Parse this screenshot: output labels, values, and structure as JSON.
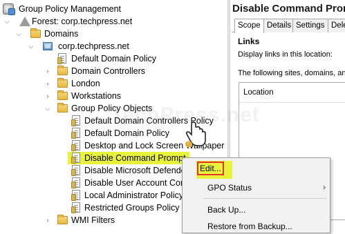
{
  "tree": {
    "items": [
      {
        "label": "Group Policy Management",
        "icon": "gpm-icon",
        "expander": "",
        "selected": false
      },
      {
        "label": "Forest: corp.techpress.net",
        "icon": "forest-icon",
        "expander": "expanded",
        "selected": false
      },
      {
        "label": "Domains",
        "icon": "folder-icon",
        "expander": "expanded",
        "selected": false
      },
      {
        "label": "corp.techpress.net",
        "icon": "domain-icon",
        "expander": "expanded",
        "selected": false
      },
      {
        "label": "Default Domain Policy",
        "icon": "gpo-link-icon",
        "expander": "",
        "selected": false
      },
      {
        "label": "Domain Controllers",
        "icon": "folder-icon",
        "expander": "collapsed",
        "selected": false
      },
      {
        "label": "London",
        "icon": "folder-icon",
        "expander": "collapsed",
        "selected": false
      },
      {
        "label": "Workstations",
        "icon": "folder-icon",
        "expander": "collapsed",
        "selected": false
      },
      {
        "label": "Group Policy Objects",
        "icon": "folder-icon",
        "expander": "expanded",
        "selected": false
      },
      {
        "label": "Default Domain Controllers Policy",
        "icon": "gpo-icon",
        "expander": "",
        "selected": false
      },
      {
        "label": "Default Domain Policy",
        "icon": "gpo-icon",
        "expander": "",
        "selected": false
      },
      {
        "label": "Desktop and Lock Screen Wallpaper",
        "icon": "gpo-icon",
        "expander": "",
        "selected": false
      },
      {
        "label": "Disable Command Prompt",
        "icon": "gpo-icon",
        "expander": "",
        "selected": true
      },
      {
        "label": "Disable Microsoft Defender",
        "icon": "gpo-icon",
        "expander": "",
        "selected": false
      },
      {
        "label": "Disable User Account Control",
        "icon": "gpo-icon",
        "expander": "",
        "selected": false
      },
      {
        "label": "Local Administrator Policy",
        "icon": "gpo-icon",
        "expander": "",
        "selected": false
      },
      {
        "label": "Restricted Groups Policy",
        "icon": "gpo-icon",
        "expander": "",
        "selected": false
      },
      {
        "label": "WMI Filters",
        "icon": "folder-icon",
        "expander": "collapsed",
        "selected": false
      }
    ]
  },
  "details": {
    "title": "Disable Command Prompt",
    "tabs": [
      "Scope",
      "Details",
      "Settings",
      "Delegation"
    ],
    "active_tab": "Scope",
    "links_heading": "Links",
    "links_desc": "Display links in this location:",
    "sites_desc": "The following sites, domains, and OUs are linked to this GPO:",
    "location_column": "Location"
  },
  "context_menu": {
    "items": [
      {
        "label": "Edit...",
        "submenu": false,
        "highlighted": true
      },
      {
        "label": "GPO Status",
        "submenu": true,
        "highlighted": false
      },
      {
        "label": "Back Up...",
        "submenu": false,
        "highlighted": false
      },
      {
        "label": "Restore from Backup...",
        "submenu": false,
        "highlighted": false
      }
    ]
  },
  "watermark": "TechPress.net",
  "colors": {
    "highlight": "#e9f23a",
    "annotation_red": "#e8312b",
    "menu_bg": "#f2f2f2"
  }
}
